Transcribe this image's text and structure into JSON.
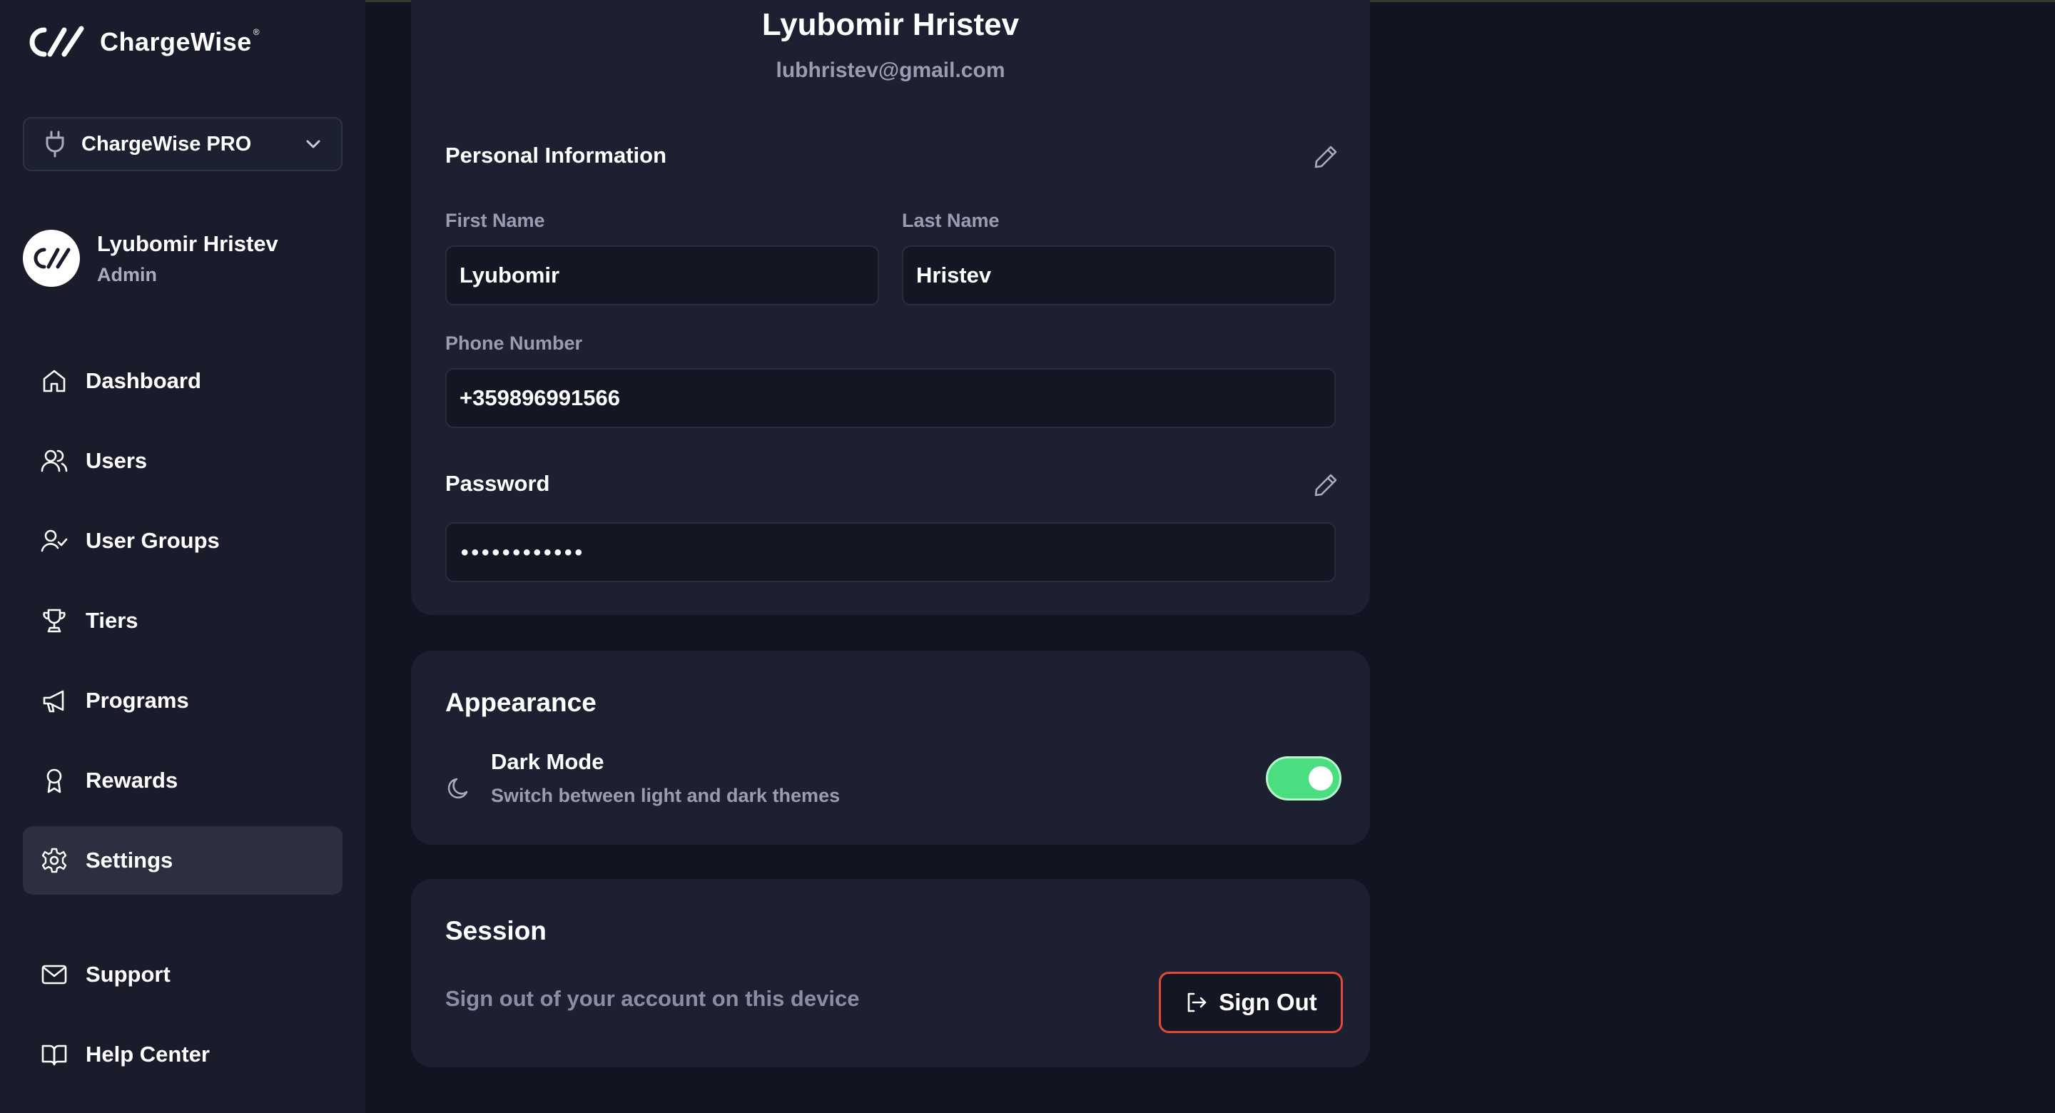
{
  "brand": {
    "name": "ChargeWise",
    "mark": "®"
  },
  "org_selector": {
    "value": "ChargeWise PRO",
    "icon": "plug-icon"
  },
  "user": {
    "name": "Lyubomir Hristev",
    "role": "Admin",
    "email": "lubhristev@gmail.com"
  },
  "nav": [
    {
      "label": "Dashboard",
      "icon": "home-icon"
    },
    {
      "label": "Users",
      "icon": "users-icon"
    },
    {
      "label": "User Groups",
      "icon": "user-check-icon"
    },
    {
      "label": "Tiers",
      "icon": "trophy-icon"
    },
    {
      "label": "Programs",
      "icon": "megaphone-icon"
    },
    {
      "label": "Rewards",
      "icon": "award-icon"
    },
    {
      "label": "Settings",
      "icon": "gear-icon",
      "active": true
    },
    {
      "label": "Support",
      "icon": "mail-icon"
    },
    {
      "label": "Help Center",
      "icon": "book-icon"
    }
  ],
  "personal": {
    "title": "Personal Information",
    "first_name_label": "First Name",
    "first_name": "Lyubomir",
    "last_name_label": "Last Name",
    "last_name": "Hristev",
    "phone_label": "Phone Number",
    "phone": "+359896991566"
  },
  "password": {
    "title": "Password",
    "masked": "••••••••••••"
  },
  "appearance": {
    "title": "Appearance",
    "dark_mode_title": "Dark Mode",
    "dark_mode_subtitle": "Switch between light and dark themes",
    "dark_mode_on": true
  },
  "session": {
    "title": "Session",
    "subtitle": "Sign out of your account on this device",
    "sign_out_label": "Sign Out"
  },
  "colors": {
    "accent_green": "#4ade80",
    "danger": "#e04a3a",
    "sidebar_bg": "#1a1c2c",
    "card_bg": "#1d2030"
  }
}
